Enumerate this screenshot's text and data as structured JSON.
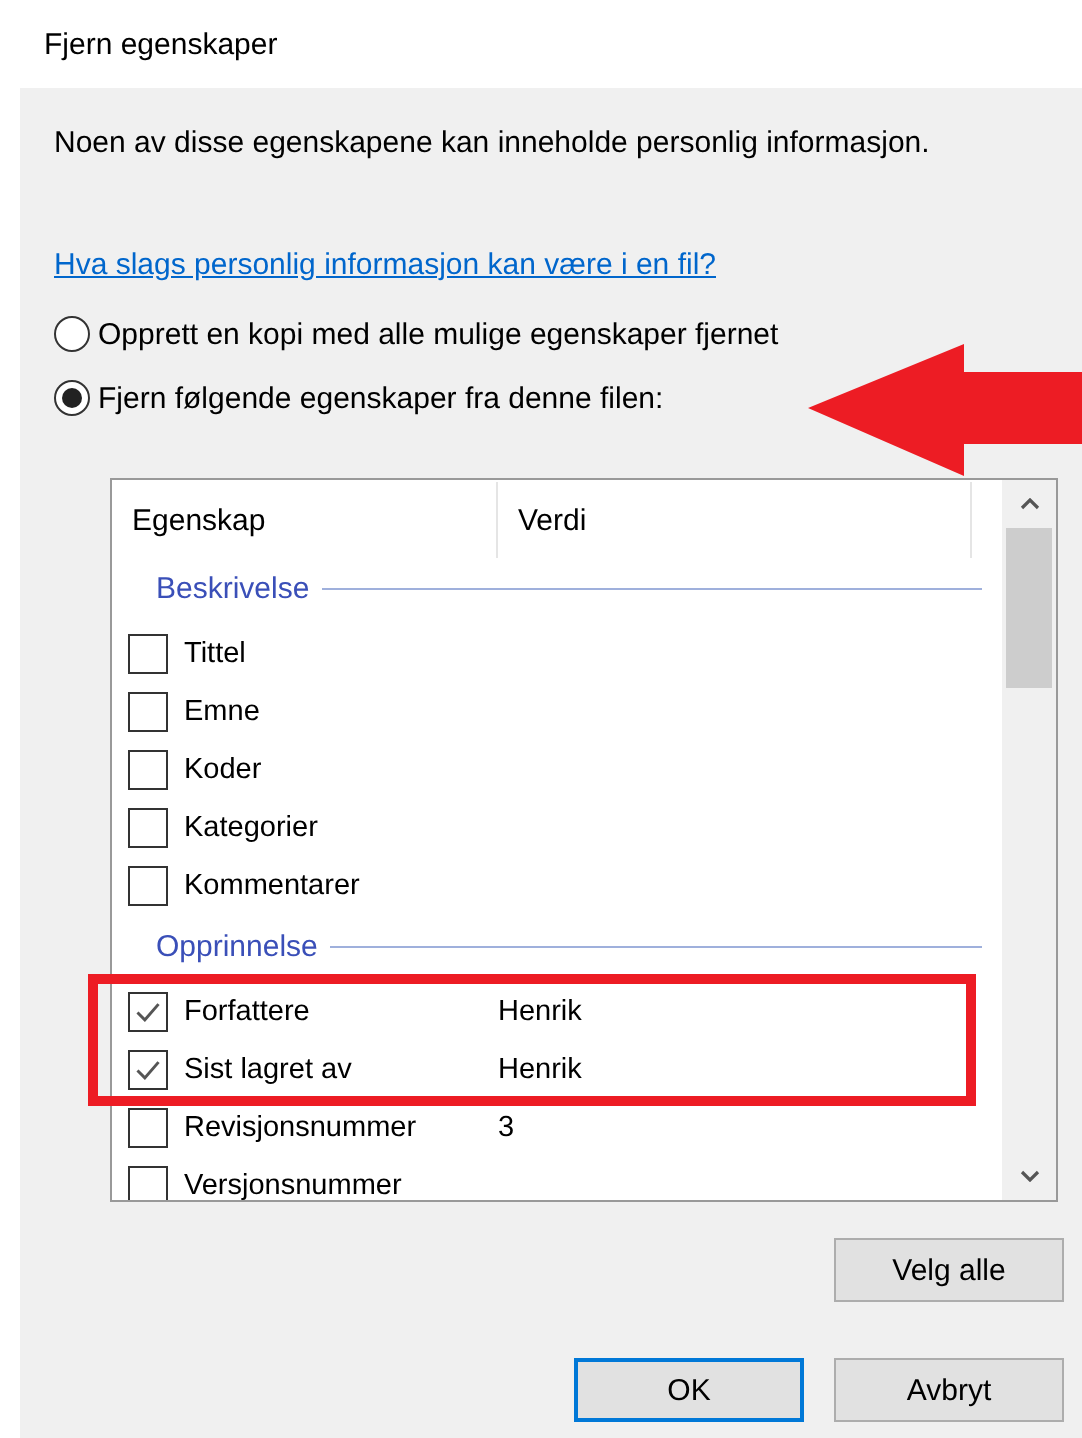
{
  "window": {
    "title": "Fjern egenskaper"
  },
  "info_text": "Noen av disse egenskapene kan inneholde personlig informasjon.",
  "help_link": "Hva slags personlig informasjon kan være i en fil?",
  "options": [
    {
      "label": "Opprett en kopi med alle mulige egenskaper fjernet",
      "selected": false
    },
    {
      "label": "Fjern følgende egenskaper fra denne filen:",
      "selected": true
    }
  ],
  "table": {
    "columns": [
      "Egenskap",
      "Verdi"
    ],
    "groups": [
      {
        "name": "Beskrivelse",
        "rows": [
          {
            "property": "Tittel",
            "checked": false
          },
          {
            "property": "Emne",
            "checked": false
          },
          {
            "property": "Koder",
            "checked": false
          },
          {
            "property": "Kategorier",
            "checked": false
          },
          {
            "property": "Kommentarer",
            "checked": false
          }
        ]
      },
      {
        "name": "Opprinnelse",
        "rows": [
          {
            "property": "Forfattere",
            "value": "Henrik",
            "checked": true
          },
          {
            "property": "Sist lagret av",
            "value": "Henrik",
            "checked": true
          },
          {
            "property": "Revisjonsnummer",
            "value": "3",
            "checked": false
          },
          {
            "property": "Versjonsnummer",
            "checked": false
          }
        ]
      }
    ]
  },
  "select_all_button": "Velg alle",
  "dialog_buttons": [
    {
      "label": "OK",
      "default": true
    },
    {
      "label": "Avbryt",
      "default": false
    }
  ]
}
